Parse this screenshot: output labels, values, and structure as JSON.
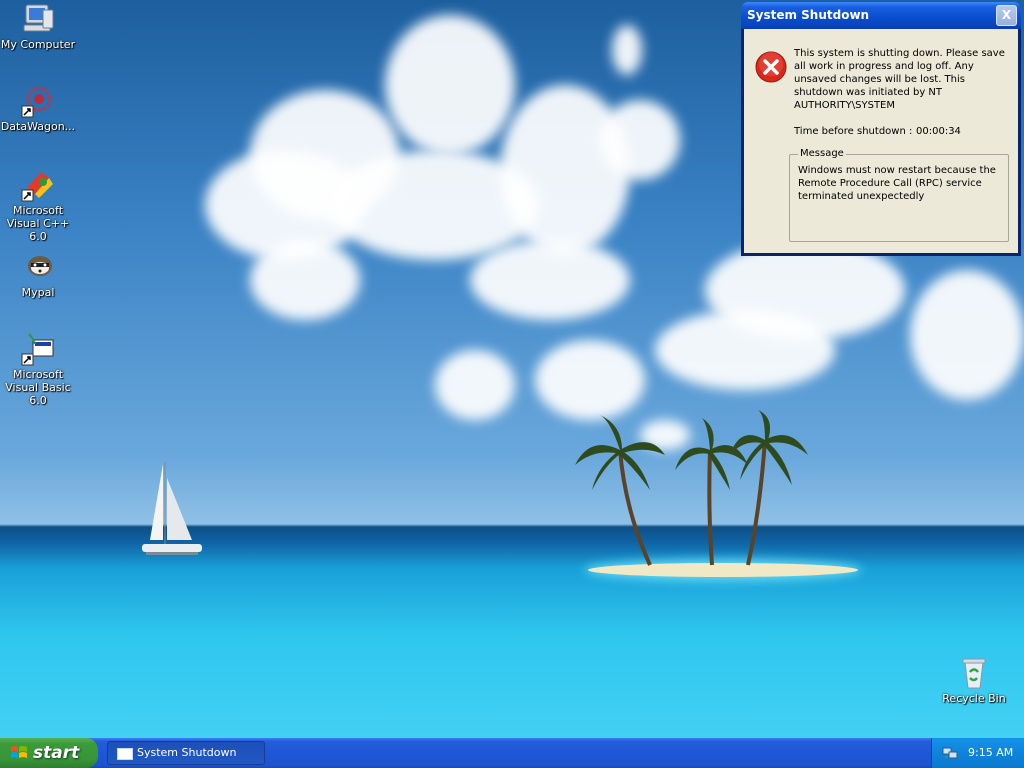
{
  "desktop": {
    "icons": [
      {
        "label": "My Computer",
        "icon": "my-computer-icon"
      },
      {
        "label": "DataWagon...",
        "icon": "datawagon-icon"
      },
      {
        "label": "Microsoft Visual C++ 6.0",
        "icon": "visual-cpp-icon"
      },
      {
        "label": "Mypal",
        "icon": "mypal-icon"
      },
      {
        "label": "Microsoft Visual Basic 6.0",
        "icon": "visual-basic-icon"
      },
      {
        "label": "Recycle Bin",
        "icon": "recycle-bin-icon"
      }
    ]
  },
  "dialog": {
    "title": "System Shutdown",
    "close_label": "X",
    "intro": "This system is shutting down. Please save all work in progress and log off. Any unsaved changes will be lost. This shutdown was initiated by NT AUTHORITY\\SYSTEM",
    "time_label": "Time before shutdown :",
    "time_value": "00:00:34",
    "message_legend": "Message",
    "message_text": "Windows must now restart because the Remote Procedure Call (RPC) service terminated unexpectedly"
  },
  "taskbar": {
    "start_label": "start",
    "task_button_label": "System Shutdown",
    "clock": "9:15 AM"
  },
  "colors": {
    "taskbar_blue": "#245edb",
    "start_green": "#3c9a3a",
    "dialog_title_blue": "#0a4fd0",
    "dialog_body": "#ece9d8",
    "error_red": "#d9271c"
  }
}
